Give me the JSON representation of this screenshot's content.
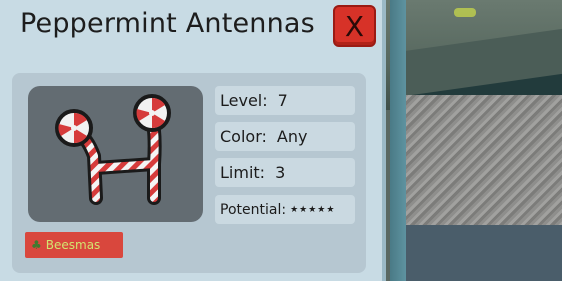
{
  "item": {
    "title": "Peppermint Antennas",
    "close_label": "X",
    "icon": "peppermint-antennas-icon"
  },
  "stats": {
    "level_label": "Level:",
    "level_value": "7",
    "color_label": "Color:",
    "color_value": "Any",
    "limit_label": "Limit:",
    "limit_value": "3",
    "potential_label": "Potential:",
    "potential_value": "★★★★★"
  },
  "tag": {
    "label": "Beesmas",
    "icon": "tree-icon"
  },
  "colors": {
    "panel_bg": "#c8dbe4",
    "close_red": "#d73228",
    "tag_red": "#d9473d",
    "tag_text": "#d4e46f"
  }
}
